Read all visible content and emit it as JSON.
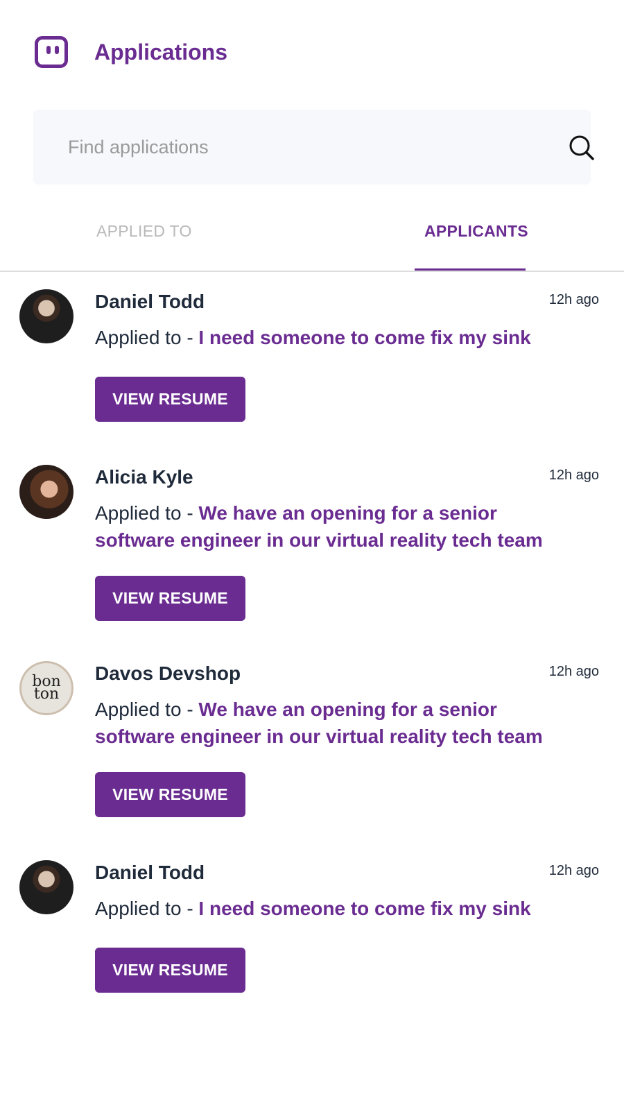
{
  "header": {
    "title": "Applications",
    "logo_icon": "chat-bubble-logo-icon"
  },
  "search": {
    "placeholder": "Find applications",
    "icon": "search-icon"
  },
  "tabs": [
    {
      "label": "APPLIED TO",
      "active": false
    },
    {
      "label": "APPLICANTS",
      "active": true
    }
  ],
  "colors": {
    "brand": "#6a2c91",
    "text": "#1f2a3a",
    "muted": "#b9b9b9",
    "search_bg": "#f7f8fc"
  },
  "applicants": [
    {
      "name": "Daniel Todd",
      "time": "12h ago",
      "prefix": "Applied to - ",
      "job": "I need someone to come fix my sink",
      "button": "VIEW RESUME"
    },
    {
      "name": "Alicia Kyle",
      "time": "12h ago",
      "prefix": "Applied to - ",
      "job": "We have an opening for a senior software engineer in our virtual reality tech team",
      "button": "VIEW RESUME"
    },
    {
      "name": "Davos Devshop",
      "time": "12h ago",
      "prefix": "Applied to - ",
      "job": "We have an opening for a senior software engineer in our virtual reality tech team",
      "button": "VIEW RESUME",
      "avatar_text": "bon ton"
    },
    {
      "name": "Daniel Todd",
      "time": "12h ago",
      "prefix": "Applied to - ",
      "job": "I need someone to come fix my sink",
      "button": "VIEW RESUME"
    }
  ]
}
